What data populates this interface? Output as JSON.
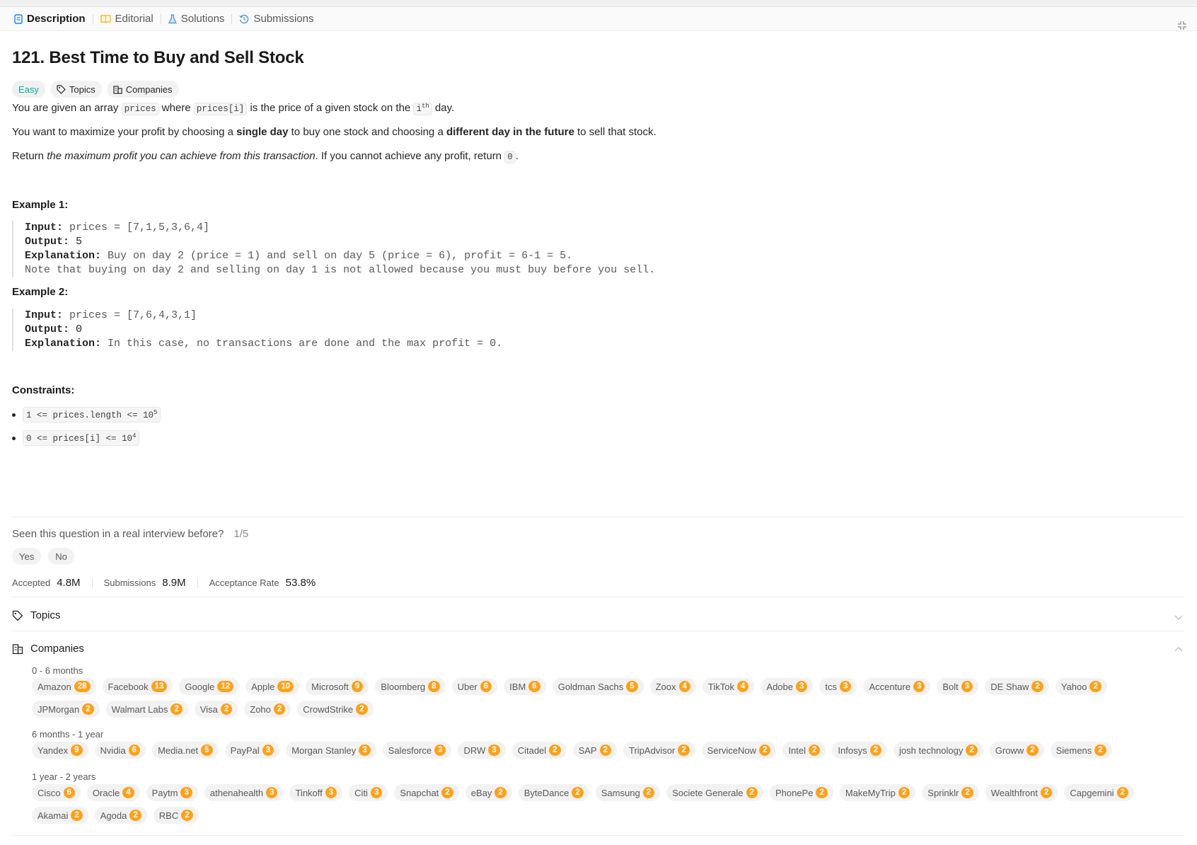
{
  "tabs": {
    "description": "Description",
    "editorial": "Editorial",
    "solutions": "Solutions",
    "submissions": "Submissions"
  },
  "problem": {
    "title": "121. Best Time to Buy and Sell Stock",
    "difficulty": "Easy",
    "topics_label": "Topics",
    "companies_label": "Companies",
    "p1": [
      "You are given an array ",
      "prices",
      " where ",
      "prices[i]",
      " is the price of a given stock on the ",
      "i",
      "th",
      " day."
    ],
    "p2": [
      "You want to maximize your profit by choosing a ",
      "single day",
      " to buy one stock and choosing a ",
      "different day in the future",
      " to sell that stock."
    ],
    "p3": [
      "Return ",
      "the maximum profit you can achieve from this transaction",
      ". If you cannot achieve any profit, return ",
      "0",
      "."
    ],
    "example1_title": "Example 1:",
    "example1": {
      "input_label": "Input:",
      "input": " prices = [7,1,5,3,6,4]",
      "output_label": "Output:",
      "output": " 5",
      "expl_label": "Explanation:",
      "expl": " Buy on day 2 (price = 1) and sell on day 5 (price = 6), profit = 6-1 = 5.",
      "note": "Note that buying on day 2 and selling on day 1 is not allowed because you must buy before you sell."
    },
    "example2_title": "Example 2:",
    "example2": {
      "input_label": "Input:",
      "input": " prices = [7,6,4,3,1]",
      "output_label": "Output:",
      "output": " 0",
      "expl_label": "Explanation:",
      "expl": " In this case, no transactions are done and the max profit = 0."
    },
    "constraints_title": "Constraints:",
    "c1": [
      "1 <= prices.length <= 10",
      "5"
    ],
    "c2": [
      "0 <= prices[i] <= 10",
      "4"
    ]
  },
  "seen": {
    "question": "Seen this question in a real interview before?",
    "fraction": "1/5",
    "yes": "Yes",
    "no": "No"
  },
  "stats": {
    "accepted_label": "Accepted",
    "accepted": "4.8M",
    "submissions_label": "Submissions",
    "submissions": "8.9M",
    "rate_label": "Acceptance Rate",
    "rate": "53.8%"
  },
  "sections": {
    "topics": "Topics",
    "companies": "Companies"
  },
  "companies": [
    {
      "period": "0 - 6 months",
      "rows": [
        [
          [
            "Amazon",
            "28"
          ],
          [
            "Facebook",
            "13"
          ],
          [
            "Google",
            "12"
          ],
          [
            "Apple",
            "10"
          ],
          [
            "Microsoft",
            "9"
          ],
          [
            "Bloomberg",
            "8"
          ],
          [
            "Uber",
            "6"
          ],
          [
            "IBM",
            "6"
          ],
          [
            "Goldman Sachs",
            "5"
          ],
          [
            "Zoox",
            "4"
          ],
          [
            "TikTok",
            "4"
          ],
          [
            "Adobe",
            "3"
          ],
          [
            "tcs",
            "3"
          ],
          [
            "Accenture",
            "3"
          ],
          [
            "Bolt",
            "3"
          ],
          [
            "DE Shaw",
            "2"
          ],
          [
            "Yahoo",
            "2"
          ]
        ],
        [
          [
            "JPMorgan",
            "2"
          ],
          [
            "Walmart Labs",
            "2"
          ],
          [
            "Visa",
            "2"
          ],
          [
            "Zoho",
            "2"
          ],
          [
            "CrowdStrike",
            "2"
          ]
        ]
      ]
    },
    {
      "period": "6 months - 1 year",
      "rows": [
        [
          [
            "Yandex",
            "9"
          ],
          [
            "Nvidia",
            "6"
          ],
          [
            "Media.net",
            "5"
          ],
          [
            "PayPal",
            "3"
          ],
          [
            "Morgan Stanley",
            "3"
          ],
          [
            "Salesforce",
            "3"
          ],
          [
            "DRW",
            "3"
          ],
          [
            "Citadel",
            "2"
          ],
          [
            "SAP",
            "2"
          ],
          [
            "TripAdvisor",
            "2"
          ],
          [
            "ServiceNow",
            "2"
          ],
          [
            "Intel",
            "2"
          ],
          [
            "Infosys",
            "2"
          ],
          [
            "josh technology",
            "2"
          ],
          [
            "Groww",
            "2"
          ],
          [
            "Siemens",
            "2"
          ]
        ]
      ]
    },
    {
      "period": "1 year - 2 years",
      "rows": [
        [
          [
            "Cisco",
            "6"
          ],
          [
            "Oracle",
            "4"
          ],
          [
            "Paytm",
            "3"
          ],
          [
            "athenahealth",
            "3"
          ],
          [
            "Tinkoff",
            "3"
          ],
          [
            "Citi",
            "3"
          ],
          [
            "Snapchat",
            "2"
          ],
          [
            "eBay",
            "2"
          ],
          [
            "ByteDance",
            "2"
          ],
          [
            "Samsung",
            "2"
          ],
          [
            "Societe Generale",
            "2"
          ],
          [
            "PhonePe",
            "2"
          ],
          [
            "MakeMyTrip",
            "2"
          ],
          [
            "Sprinklr",
            "2"
          ],
          [
            "Wealthfront",
            "2"
          ],
          [
            "Capgemini",
            "2"
          ]
        ],
        [
          [
            "Akamai",
            "2"
          ],
          [
            "Agoda",
            "2"
          ],
          [
            "RBC",
            "2"
          ]
        ]
      ]
    }
  ],
  "colors": {
    "easy": "#00afa0",
    "badge": "#ffa116",
    "tab_icon_description": "#007aff",
    "tab_icon_editorial": "#ffb800",
    "tab_icon_solutions": "#5b9bd5"
  }
}
